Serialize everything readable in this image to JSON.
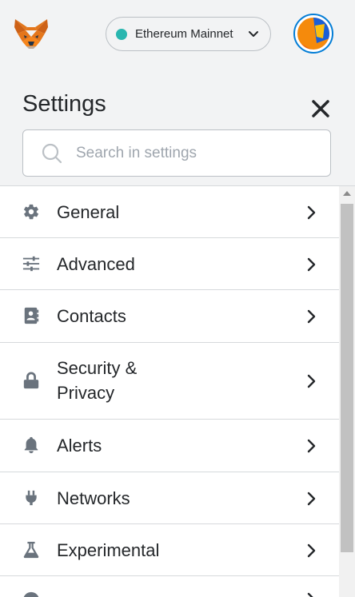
{
  "header": {
    "network_label": "Ethereum Mainnet",
    "network_color": "#29b6af",
    "account_avatar": "jazzicon-avatar"
  },
  "settings": {
    "title": "Settings",
    "close_icon": "close-icon",
    "search": {
      "placeholder": "Search in settings",
      "value": ""
    }
  },
  "menu": [
    {
      "label": "General",
      "icon": "gear-icon"
    },
    {
      "label": "Advanced",
      "icon": "sliders-icon"
    },
    {
      "label": "Contacts",
      "icon": "address-book-icon"
    },
    {
      "label": "Security &\nPrivacy",
      "icon": "lock-icon"
    },
    {
      "label": "Alerts",
      "icon": "bell-icon"
    },
    {
      "label": "Networks",
      "icon": "plug-icon"
    },
    {
      "label": "Experimental",
      "icon": "flask-icon"
    }
  ],
  "colors": {
    "accent": "#037dd6",
    "text": "#24272a",
    "icon": "#6a737d"
  }
}
